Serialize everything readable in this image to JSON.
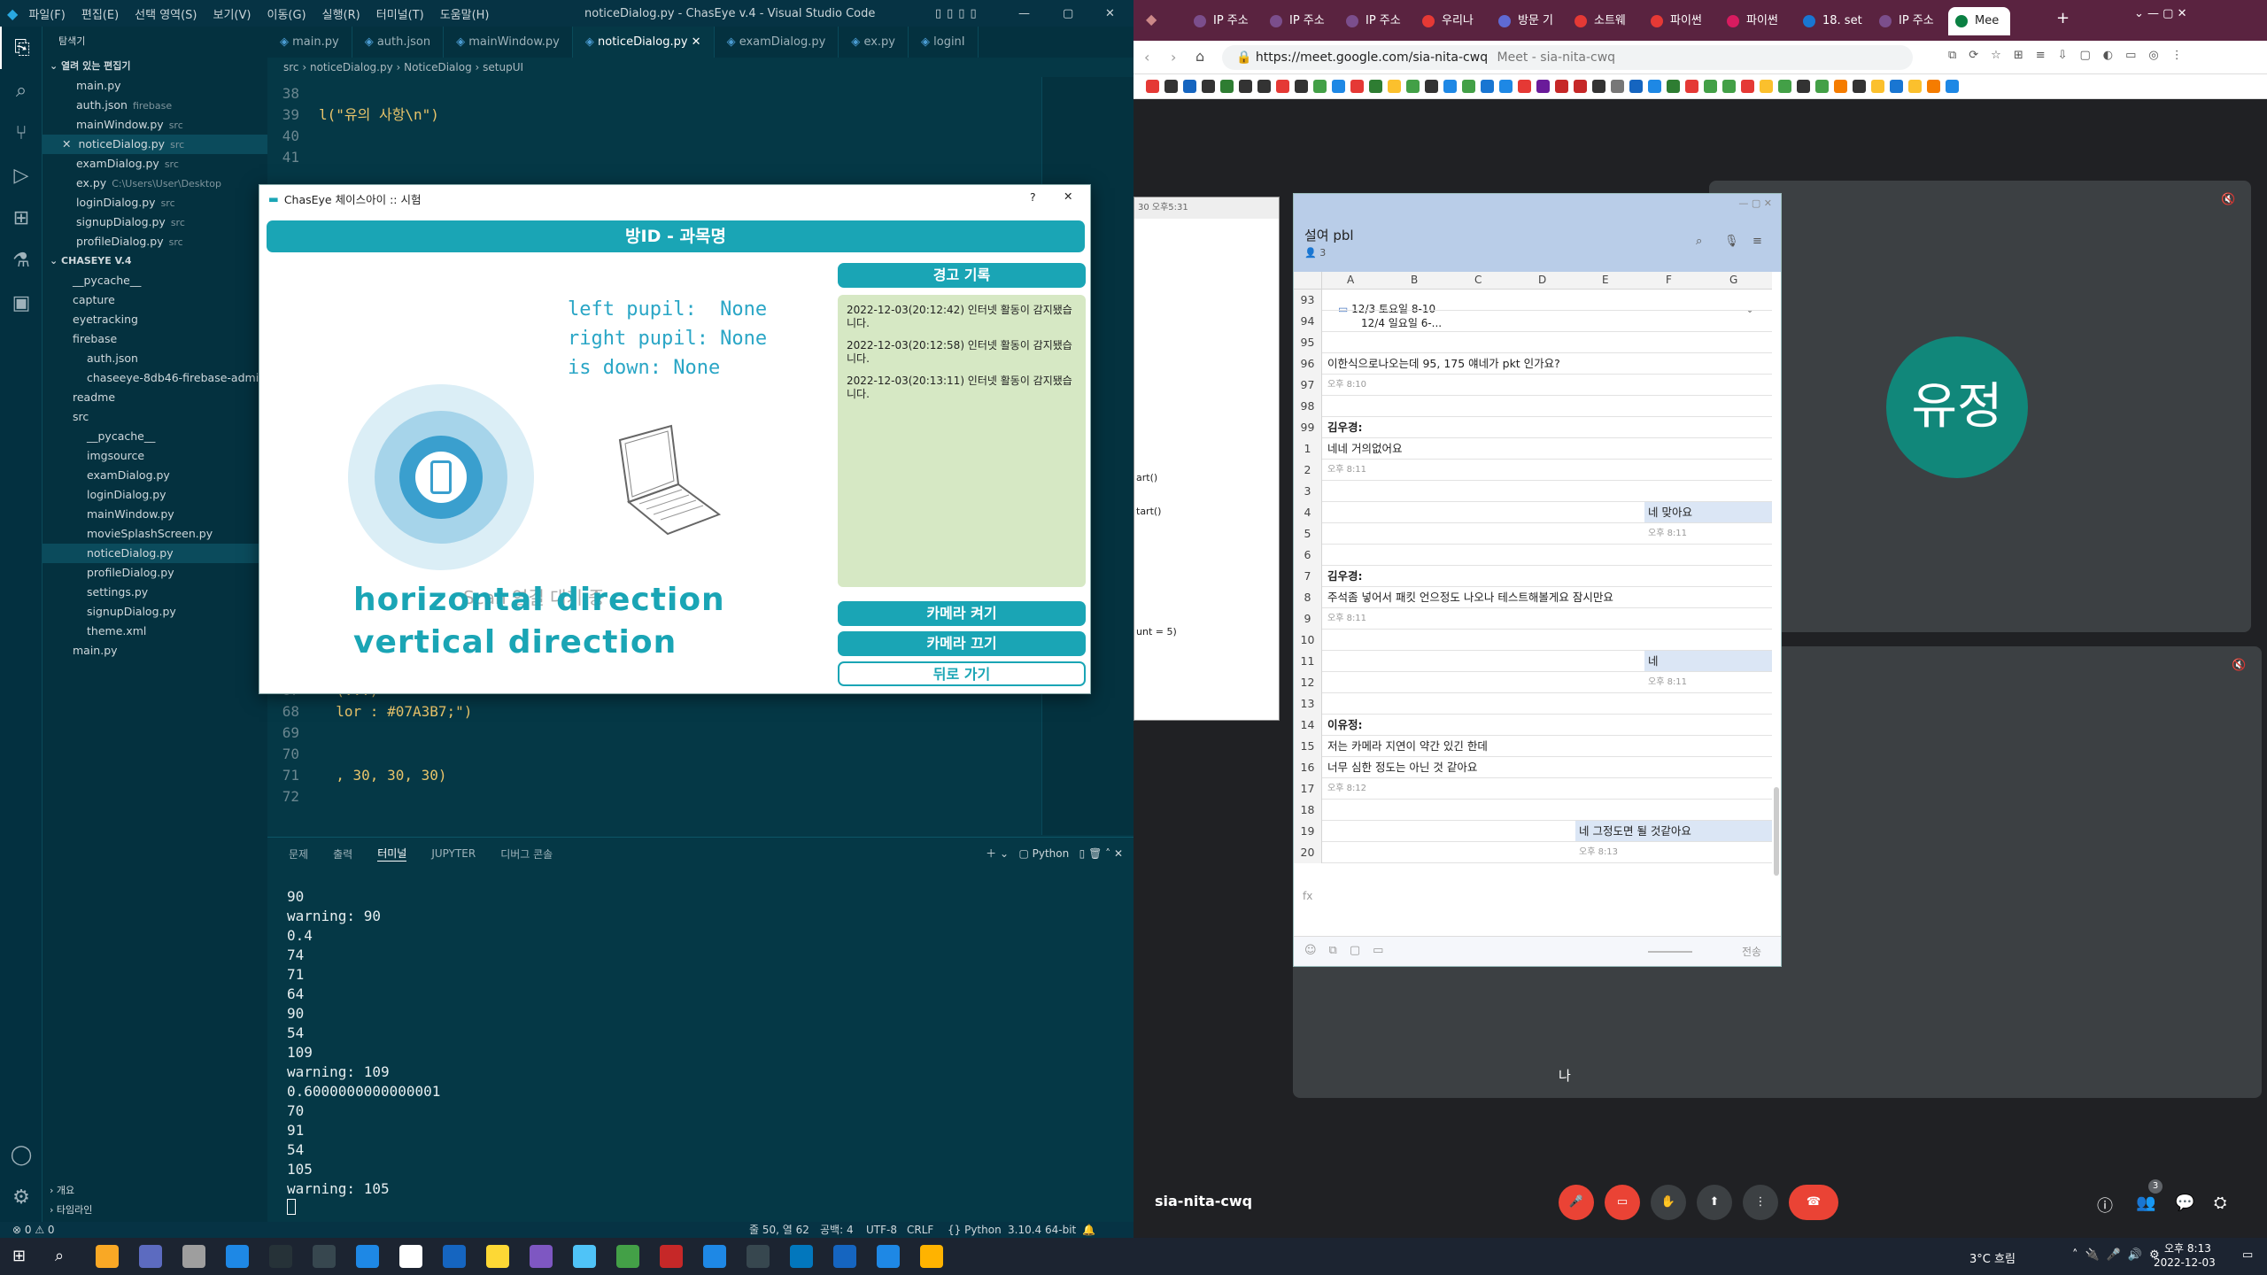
{
  "vscode": {
    "title": "noticeDialog.py - ChasEye v.4 - Visual Studio Code",
    "menu": [
      "파일(F)",
      "편집(E)",
      "선택 영역(S)",
      "보기(V)",
      "이동(G)",
      "실행(R)",
      "터미널(T)",
      "도움말(H)"
    ],
    "sidebar_title": "탐색기",
    "open_editors_label": "열려 있는 편집기",
    "open_editors": [
      {
        "name": "main.py",
        "desc": ""
      },
      {
        "name": "auth.json",
        "desc": "firebase"
      },
      {
        "name": "mainWindow.py",
        "desc": "src"
      },
      {
        "name": "noticeDialog.py",
        "desc": "src"
      },
      {
        "name": "examDialog.py",
        "desc": "src"
      },
      {
        "name": "ex.py",
        "desc": "C:\\Users\\User\\Desktop"
      },
      {
        "name": "loginDialog.py",
        "desc": "src"
      },
      {
        "name": "signupDialog.py",
        "desc": "src"
      },
      {
        "name": "profileDialog.py",
        "desc": "src"
      }
    ],
    "workspace_label": "CHASEYE V.4",
    "workspace": [
      {
        "name": "__pycache__"
      },
      {
        "name": "capture"
      },
      {
        "name": "eyetracking"
      },
      {
        "name": "firebase"
      },
      {
        "name": "auth.json"
      },
      {
        "name": "chaseeye-8db46-firebase-adminsd..."
      },
      {
        "name": "readme"
      },
      {
        "name": "src"
      },
      {
        "name": "__pycache__"
      },
      {
        "name": "imgsource"
      },
      {
        "name": "examDialog.py"
      },
      {
        "name": "loginDialog.py"
      },
      {
        "name": "mainWindow.py"
      },
      {
        "name": "movieSplashScreen.py"
      },
      {
        "name": "noticeDialog.py"
      },
      {
        "name": "profileDialog.py"
      },
      {
        "name": "settings.py"
      },
      {
        "name": "signupDialog.py"
      },
      {
        "name": "theme.xml"
      },
      {
        "name": "main.py"
      }
    ],
    "outline_label": "개요",
    "timeline_label": "타임라인",
    "tabs": [
      "main.py",
      "auth.json",
      "mainWindow.py",
      "noticeDialog.py",
      "examDialog.py",
      "ex.py",
      "loginI"
    ],
    "breadcrumb": [
      "src",
      "noticeDialog.py",
      "NoticeDialog",
      "setupUI"
    ],
    "code_top": [
      {
        "n": "38",
        "t": ""
      },
      {
        "n": "39",
        "t": "l(\"유의 사항\\n\")"
      },
      {
        "n": "40",
        "t": ""
      },
      {
        "n": "41",
        "t": ""
      }
    ],
    "code_bottom": [
      {
        "n": "67",
        "t": "  (...)"
      },
      {
        "n": "68",
        "t": "  lor : #07A3B7;\")"
      },
      {
        "n": "69",
        "t": ""
      },
      {
        "n": "70",
        "t": ""
      },
      {
        "n": "71",
        "t": "  , 30, 30, 30)"
      },
      {
        "n": "72",
        "t": ""
      }
    ],
    "panel_tabs": [
      "문제",
      "출력",
      "터미널",
      "JUPYTER",
      "디버그 콘솔"
    ],
    "panel_right": "Python",
    "terminal": [
      "90",
      "warning: 90",
      "0.4",
      "74",
      "71",
      "64",
      "90",
      "54",
      "109",
      "warning: 109",
      "0.6000000000000001",
      "70",
      "91",
      "54",
      "105",
      "warning: 105"
    ],
    "status_left": "⊗ 0 ⚠ 0",
    "status_right": [
      "줄 50, 열 62",
      "공백: 4",
      "UTF-8",
      "CRLF",
      "{} Python",
      "3.10.4 64-bit"
    ]
  },
  "dialog": {
    "title": "ChasEye 체이스아이 :: 시험",
    "help": "?",
    "close": "✕",
    "header": "방ID - 과목명",
    "pupil_text": [
      "left pupil:  None",
      "right pupil: None",
      "is down: None"
    ],
    "waiting_text": "Scan 연결 대기 중",
    "horizontal": "horizontal direction",
    "vertical": "vertical direction",
    "warn_title": "경고 기록",
    "warnings": [
      "2022-12-03(20:12:42) 인터넷 활동이 감지됐습니다.",
      "2022-12-03(20:12:58) 인터넷 활동이 감지됐습니다.",
      "2022-12-03(20:13:11) 인터넷 활동이 감지됐습니다."
    ],
    "btn_camera_on": "카메라 켜기",
    "btn_camera_off": "카메라 끄기",
    "btn_back": "뒤로 가기"
  },
  "chrome": {
    "tabs": [
      "IP 주소",
      "IP 주소",
      "IP 주소",
      "우리나",
      "방문 기",
      "소트웨",
      "파이썬",
      "파이썬",
      "18. set",
      "IP 주소",
      "Mee"
    ],
    "url": "https://meet.google.com/sia-nita-cwq",
    "url_suffix": "Meet - sia-nita-cwq"
  },
  "meet": {
    "participant_initial": "유정",
    "self_label": "나",
    "meeting_code": "sia-nita-cwq",
    "people_count": "3",
    "bg_window_title": "30 오후5:31",
    "bg_code": [
      "art()",
      "tart()",
      "unt = 5)"
    ]
  },
  "chat": {
    "title": "설여 pbl",
    "members": "3",
    "columns": [
      "A",
      "B",
      "C",
      "D",
      "E",
      "F",
      "G"
    ],
    "pinned": [
      "12/3 토요일 8-10",
      "12/4 일요일 6-..."
    ],
    "rows": [
      {
        "n": "93",
        "t": ""
      },
      {
        "n": "94",
        "t": ""
      },
      {
        "n": "95",
        "t": ""
      },
      {
        "n": "96",
        "t": "이한식으로나오는데 95, 175 얘네가 pkt 인가요?"
      },
      {
        "n": "97",
        "t": "오후 8:10"
      },
      {
        "n": "98",
        "t": ""
      },
      {
        "n": "99",
        "t": "김우경:"
      },
      {
        "n": "1",
        "t": "네네 거의없어요"
      },
      {
        "n": "2",
        "t": "오후 8:11"
      },
      {
        "n": "3",
        "t": ""
      },
      {
        "n": "4",
        "t": "네 맞아요"
      },
      {
        "n": "5",
        "t": "오후 8:11"
      },
      {
        "n": "6",
        "t": ""
      },
      {
        "n": "7",
        "t": "김우경:"
      },
      {
        "n": "8",
        "t": "주석좀 넣어서 패킷 언으정도 나오나 테스트해볼게요 잠시만요"
      },
      {
        "n": "9",
        "t": "오후 8:11"
      },
      {
        "n": "10",
        "t": ""
      },
      {
        "n": "11",
        "t": "네"
      },
      {
        "n": "12",
        "t": "오후 8:11"
      },
      {
        "n": "13",
        "t": ""
      },
      {
        "n": "14",
        "t": "이유정:"
      },
      {
        "n": "15",
        "t": "저는 카메라 지연이 약간 있긴 한데"
      },
      {
        "n": "16",
        "t": "너무 심한 정도는 아닌 것 같아요"
      },
      {
        "n": "17",
        "t": "오후 8:12"
      },
      {
        "n": "18",
        "t": ""
      },
      {
        "n": "19",
        "t": "네 그정도면 될 것같아요"
      },
      {
        "n": "20",
        "t": "오후 8:13"
      }
    ],
    "formula_label": "fx",
    "send_label": "전송"
  },
  "taskbar": {
    "weather": "3°C 흐림",
    "time": "오후 8:13",
    "date": "2022-12-03"
  },
  "colors": {
    "teal": "#1aa5b5",
    "vscode_bg": "#053846",
    "meet_bg": "#202124",
    "avatar": "#11877a",
    "end_call": "#ea4335"
  }
}
